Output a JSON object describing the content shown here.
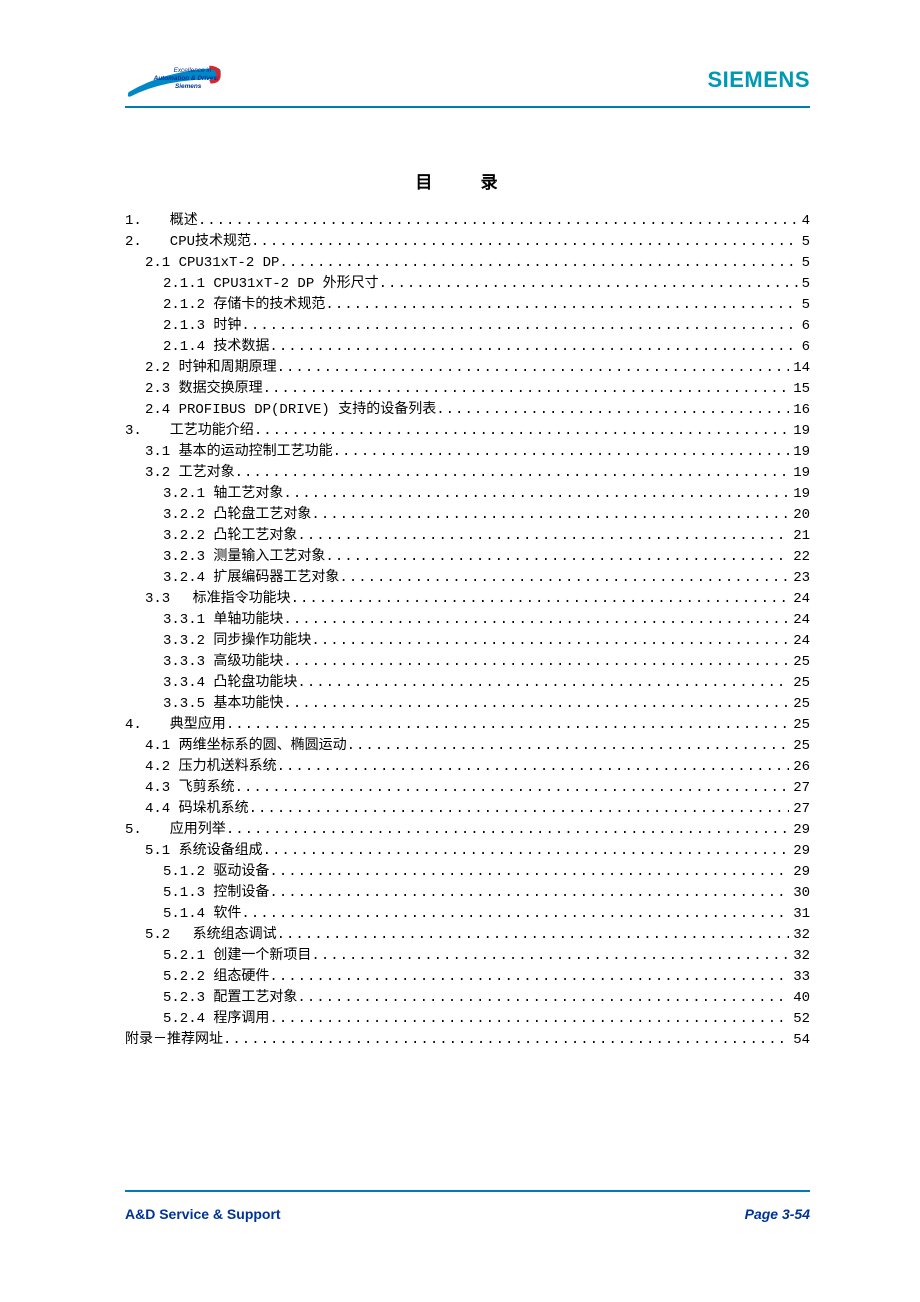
{
  "header": {
    "logo_line1": "Excellence in",
    "logo_line2": "Automation & Drives:",
    "logo_line3": "Siemens",
    "brand": "SIEMENS"
  },
  "toc_title": "目 录",
  "toc": [
    {
      "indent": 0,
      "label": "1.　　概述 ",
      "page": "4"
    },
    {
      "indent": 0,
      "label": "2.　　CPU技术规范",
      "page": "5"
    },
    {
      "indent": 1,
      "label": "2.1 CPU31xT-2 DP",
      "page": "5"
    },
    {
      "indent": 2,
      "label": "2.1.1 CPU31xT-2 DP 外形尺寸",
      "page": "5"
    },
    {
      "indent": 2,
      "label": "2.1.2 存储卡的技术规范",
      "page": "5"
    },
    {
      "indent": 2,
      "label": "2.1.3 时钟 ",
      "page": "6"
    },
    {
      "indent": 2,
      "label": "2.1.4 技术数据",
      "page": "6"
    },
    {
      "indent": 1,
      "label": "2.2 时钟和周期原理",
      "page": "14"
    },
    {
      "indent": 1,
      "label": "2.3 数据交换原理",
      "page": "15"
    },
    {
      "indent": 1,
      "label": "2.4 PROFIBUS DP(DRIVE) 支持的设备列表",
      "page": "16"
    },
    {
      "indent": 0,
      "label": "3.　　工艺功能介绍",
      "page": "19"
    },
    {
      "indent": 1,
      "label": "3.1 基本的运动控制工艺功能",
      "page": "19"
    },
    {
      "indent": 1,
      "label": "3.2 工艺对象",
      "page": "19"
    },
    {
      "indent": 2,
      "label": "3.2.1 轴工艺对象",
      "page": "19"
    },
    {
      "indent": 2,
      "label": "3.2.2 凸轮盘工艺对象",
      "page": "20"
    },
    {
      "indent": 2,
      "label": "3.2.2 凸轮工艺对象",
      "page": "21"
    },
    {
      "indent": 2,
      "label": "3.2.3 测量输入工艺对象",
      "page": "22"
    },
    {
      "indent": 2,
      "label": "3.2.4 扩展编码器工艺对象",
      "page": "23"
    },
    {
      "indent": 1,
      "label": "3.3 　标准指令功能块",
      "page": "24"
    },
    {
      "indent": 2,
      "label": "3.3.1 单轴功能块",
      "page": "24"
    },
    {
      "indent": 2,
      "label": "3.3.2 同步操作功能块",
      "page": "24"
    },
    {
      "indent": 2,
      "label": "3.3.3 高级功能块",
      "page": "25"
    },
    {
      "indent": 2,
      "label": "3.3.4 凸轮盘功能块",
      "page": "25"
    },
    {
      "indent": 2,
      "label": "3.3.5 基本功能快",
      "page": "25"
    },
    {
      "indent": 0,
      "label": "4.　　典型应用",
      "page": "25"
    },
    {
      "indent": 1,
      "label": "4.1 两维坐标系的圆、椭圆运动 ",
      "page": "25"
    },
    {
      "indent": 1,
      "label": "4.2 压力机送料系统 ",
      "page": "26"
    },
    {
      "indent": 1,
      "label": "4.3 飞剪系统 ",
      "page": "27"
    },
    {
      "indent": 1,
      "label": "4.4 码垛机系统 ",
      "page": "27"
    },
    {
      "indent": 0,
      "label": "5.　　应用列举",
      "page": "29"
    },
    {
      "indent": 1,
      "label": "5.1 系统设备组成",
      "page": "29"
    },
    {
      "indent": 2,
      "label": "5.1.2 驱动设备",
      "page": "29"
    },
    {
      "indent": 2,
      "label": "5.1.3 控制设备",
      "page": "30"
    },
    {
      "indent": 2,
      "label": "5.1.4 软件",
      "page": "31"
    },
    {
      "indent": 1,
      "label": "5.2 　系统组态调试 ",
      "page": "32"
    },
    {
      "indent": 2,
      "label": "5.2.1 创建一个新项目",
      "page": "32"
    },
    {
      "indent": 2,
      "label": "5.2.2 组态硬件",
      "page": "33"
    },
    {
      "indent": 2,
      "label": "5.2.3 配置工艺对象",
      "page": "40"
    },
    {
      "indent": 2,
      "label": "5.2.4 程序调用",
      "page": "52"
    },
    {
      "indent": 0,
      "label": "附录－推荐网址 ",
      "page": "54"
    }
  ],
  "footer": {
    "left": "A&D Service & Support",
    "right": "Page 3-54"
  }
}
